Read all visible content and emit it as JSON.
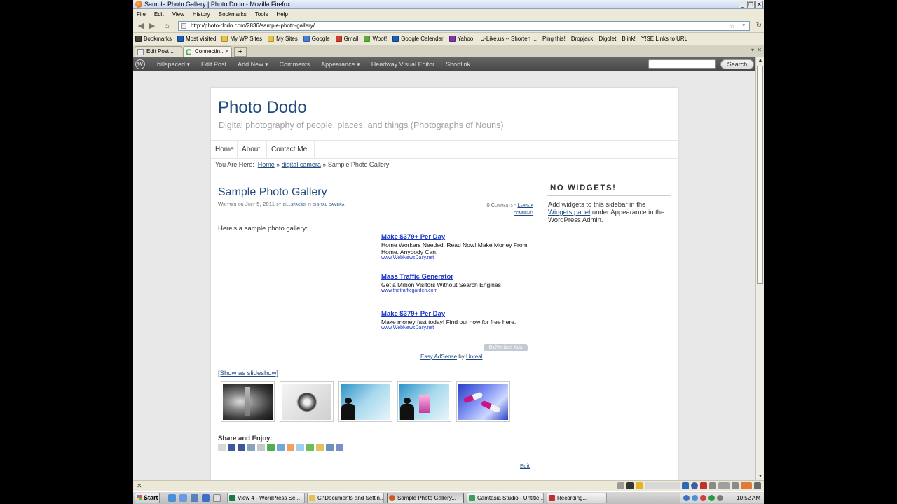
{
  "window": {
    "title": "Sample Photo Gallery | Photo Dodo - Mozilla Firefox"
  },
  "menu": [
    "File",
    "Edit",
    "View",
    "History",
    "Bookmarks",
    "Tools",
    "Help"
  ],
  "nav": {
    "url": "http://photo-dodo.com/2836/sample-photo-gallery/"
  },
  "bookmarks": [
    {
      "label": "Bookmarks",
      "icon": "bookmarks-icon"
    },
    {
      "label": "Most Visited",
      "icon": "most-visited-icon"
    },
    {
      "label": "My WP Sites",
      "icon": "folder-icon"
    },
    {
      "label": "My Sites",
      "icon": "folder-icon"
    },
    {
      "label": "Google",
      "icon": "google-icon"
    },
    {
      "label": "Gmail",
      "icon": "gmail-icon"
    },
    {
      "label": "Woot!",
      "icon": "woot-icon"
    },
    {
      "label": "Google Calendar",
      "icon": "calendar-icon"
    },
    {
      "label": "Yahoo!",
      "icon": "yahoo-icon"
    },
    {
      "label": "U-Like.us -- Shorten ...",
      "icon": "page-icon"
    },
    {
      "label": "Ping this!",
      "icon": "page-icon"
    },
    {
      "label": "Dropjack",
      "icon": "page-icon"
    },
    {
      "label": "Digolet",
      "icon": "page-icon"
    },
    {
      "label": "Blink!",
      "icon": "page-icon"
    },
    {
      "label": "Y!SE Links to URL",
      "icon": "page-icon"
    }
  ],
  "tabs": [
    {
      "label": "Edit Post ..."
    },
    {
      "label": "Connectin..."
    }
  ],
  "adminbar": {
    "items": [
      "billspaced ▾",
      "Edit Post",
      "Add New ▾",
      "Comments",
      "Appearance ▾",
      "Headway Visual Editor",
      "Shortlink"
    ],
    "search_button": "Search"
  },
  "site": {
    "title": "Photo Dodo",
    "description": "Digital photography of people, places, and things (Photographs of Nouns)",
    "nav": [
      "Home",
      "About",
      "Contact Me"
    ]
  },
  "breadcrumb": {
    "prefix": "You Are Here:",
    "home": "Home",
    "sep1": "»",
    "category": "digital camera",
    "sep2": "»",
    "current": "Sample Photo Gallery"
  },
  "post": {
    "title": "Sample Photo Gallery",
    "meta_written": "Written on",
    "meta_date": "July 5, 2011",
    "meta_by": "by",
    "meta_author": "billspaced",
    "meta_in": "in",
    "meta_category": "digital camera",
    "comments_count": "0 Comments",
    "comments_dash": "-",
    "leave_comment": "Leave a comment!",
    "intro": "Here's a sample photo gallery:",
    "show_slideshow": "[Show as slideshow]",
    "share_title": "Share and Enjoy:",
    "edit": "Edit"
  },
  "ads": [
    {
      "title": "Make $379+ Per Day",
      "body": "Home Workers Needed. Read Now! Make Money From Home. Anybody Can.",
      "url": "www.WebNewsDaily.net"
    },
    {
      "title": "Mass Traffic Generator",
      "body": "Get a Million Visitors Without Search Engines",
      "url": "www.thetrafficgarden.com"
    },
    {
      "title": "Make $379+ Per Day",
      "body": "Make money fast today! Find out how for free here.",
      "url": "www.WebNewsDaily.net"
    }
  ],
  "ads_footer": {
    "badge": "BidVertiser Ads",
    "easy": "Easy AdSense",
    "by": "by",
    "unreal": "Unreal"
  },
  "sidebar": {
    "title": "NO WIDGETS!",
    "text_before": "Add widgets to this sidebar in the",
    "link": "Widgets panel",
    "text_after": "under Appearance in the WordPress Admin."
  },
  "status": {
    "close_symbol": "✕"
  },
  "taskbar": {
    "start": "Start",
    "tasks": [
      {
        "label": "View 4 - WordPress Se..."
      },
      {
        "label": "C:\\Documents and Settin..."
      },
      {
        "label": "Sample Photo Gallery..."
      },
      {
        "label": "Camtasia Studio - Untitle..."
      },
      {
        "label": "Recording..."
      }
    ],
    "clock": "10:52 AM"
  }
}
